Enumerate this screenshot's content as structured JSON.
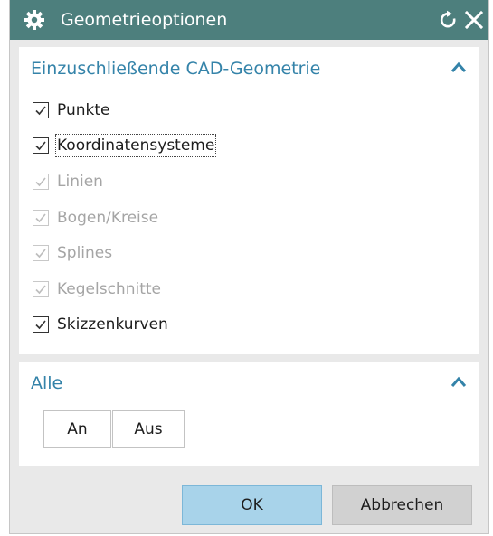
{
  "window": {
    "title": "Geometrieoptionen",
    "title_icon": "gear-icon",
    "reset_icon": "reset-icon",
    "close_icon": "close-icon",
    "titlebar_color": "#4d7f7d"
  },
  "groups": {
    "cad": {
      "title": "Einzuschließende CAD-Geometrie",
      "collapse_icon": "chevron-up-icon",
      "items": [
        {
          "label": "Punkte",
          "checked": true,
          "enabled": true
        },
        {
          "label": "Koordinatensysteme",
          "checked": true,
          "enabled": true,
          "focused": true
        },
        {
          "label": "Linien",
          "checked": true,
          "enabled": false
        },
        {
          "label": "Bogen/Kreise",
          "checked": true,
          "enabled": false
        },
        {
          "label": "Splines",
          "checked": true,
          "enabled": false
        },
        {
          "label": "Kegelschnitte",
          "checked": true,
          "enabled": false
        },
        {
          "label": "Skizzenkurven",
          "checked": true,
          "enabled": true
        }
      ]
    },
    "all": {
      "title": "Alle",
      "collapse_icon": "chevron-up-icon",
      "on_label": "An",
      "off_label": "Aus"
    }
  },
  "footer": {
    "ok_label": "OK",
    "cancel_label": "Abbrechen"
  },
  "colors": {
    "accent_text": "#3483a9",
    "ok_button": "#a8d3ea",
    "cancel_button": "#d1d1d1"
  }
}
